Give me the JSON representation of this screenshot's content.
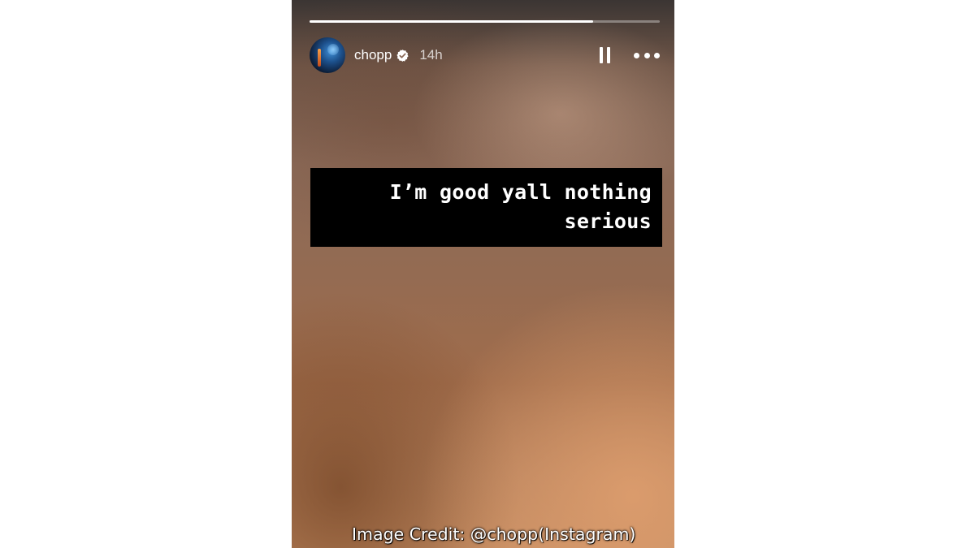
{
  "story": {
    "progress_fraction": 0.81,
    "user": {
      "username": "chopp",
      "verified": true,
      "posted_ago": "14h",
      "avatar_icon": "avatar-image"
    },
    "controls": {
      "pause_icon": "pause-icon",
      "more_icon": "more-options-icon"
    },
    "caption": "I’m good yall nothing\nserious"
  },
  "credit": "Image Credit: @chopp(Instagram)",
  "colors": {
    "caption_background": "#000000",
    "text": "#ffffff",
    "verified_badge": "#ffffff"
  }
}
